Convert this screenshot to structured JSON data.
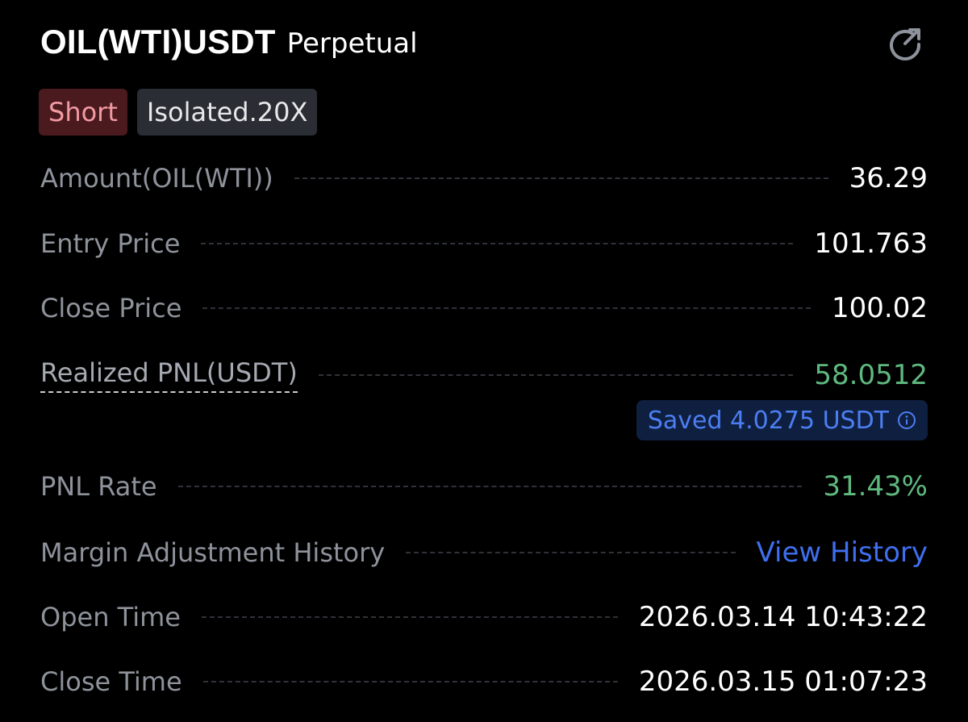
{
  "header": {
    "symbol": "OIL(WTI)USDT",
    "contract_type": "Perpetual",
    "share_icon": "share-arrow-icon"
  },
  "tags": {
    "side": "Short",
    "margin_mode": "Isolated.20X"
  },
  "rows": {
    "amount": {
      "label": "Amount(OIL(WTI))",
      "value": "36.29"
    },
    "entry_price": {
      "label": "Entry Price",
      "value": "101.763"
    },
    "close_price": {
      "label": "Close Price",
      "value": "100.02"
    },
    "realized_pnl": {
      "label": "Realized PNL(USDT)",
      "value": "58.0512"
    },
    "pnl_rate": {
      "label": "PNL Rate",
      "value": "31.43%"
    },
    "margin_history": {
      "label": "Margin Adjustment History",
      "value": "View History"
    },
    "open_time": {
      "label": "Open Time",
      "value": "2026.03.14 10:43:22"
    },
    "close_time": {
      "label": "Close Time",
      "value": "2026.03.15 01:07:23"
    }
  },
  "saved": {
    "text": "Saved 4.0275 USDT",
    "icon": "info-icon"
  },
  "colors": {
    "background": "#000000",
    "short_bg": "#4a1a1f",
    "short_text": "#f29aa2",
    "profit": "#5fb97f",
    "link": "#3f6ff0",
    "label": "#8e929b"
  }
}
